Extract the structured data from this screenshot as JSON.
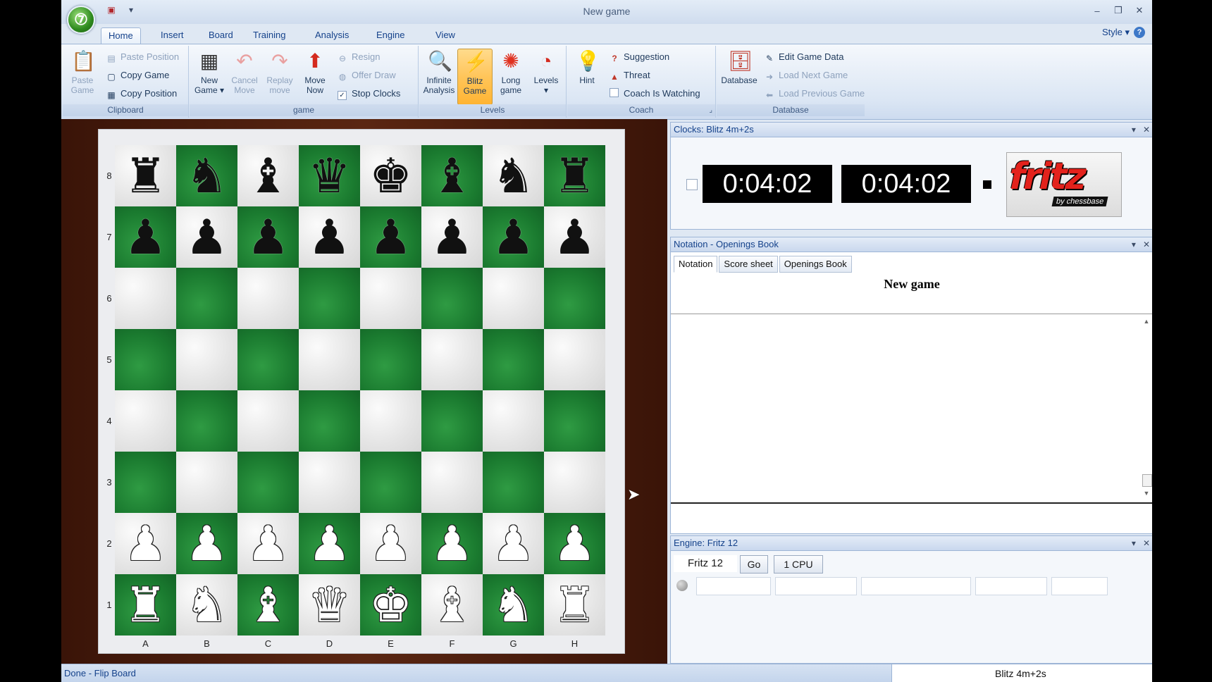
{
  "window": {
    "title": "New game",
    "app_icon": "fritz-orb-icon",
    "controls": [
      "minimize-icon",
      "restore-icon",
      "close-icon"
    ]
  },
  "ribbon": {
    "tabs": [
      "Home",
      "Insert",
      "Board",
      "Training",
      "Analysis",
      "Engine",
      "View"
    ],
    "active_tab": "Home",
    "style_label": "Style",
    "groups": {
      "clipboard": {
        "label": "Clipboard",
        "paste_game": "Paste Game",
        "paste_position": "Paste Position",
        "copy_game": "Copy Game",
        "copy_position": "Copy Position"
      },
      "game": {
        "label": "game",
        "new_game": "New Game",
        "cancel_move": "Cancel Move",
        "replay_move": "Replay move",
        "move_now": "Move Now",
        "resign": "Resign",
        "offer_draw": "Offer Draw",
        "stop_clocks": "Stop Clocks"
      },
      "levels": {
        "label": "Levels",
        "infinite_analysis": "Infinite Analysis",
        "blitz_game": "Blitz Game",
        "long_game": "Long game",
        "levels": "Levels"
      },
      "coach": {
        "label": "Coach",
        "hint": "Hint",
        "suggestion": "Suggestion",
        "threat": "Threat",
        "coach_watching": "Coach Is Watching"
      },
      "database": {
        "label": "Database",
        "database": "Database",
        "edit_game_data": "Edit Game Data",
        "load_next_game": "Load Next Game",
        "load_previous_game": "Load Previous Game"
      }
    }
  },
  "board": {
    "ranks": [
      "8",
      "7",
      "6",
      "5",
      "4",
      "3",
      "2",
      "1"
    ],
    "files": [
      "A",
      "B",
      "C",
      "D",
      "E",
      "F",
      "G",
      "H"
    ],
    "position": [
      [
        "bR",
        "bN",
        "bB",
        "bQ",
        "bK",
        "bB",
        "bN",
        "bR"
      ],
      [
        "bP",
        "bP",
        "bP",
        "bP",
        "bP",
        "bP",
        "bP",
        "bP"
      ],
      [
        "",
        "",
        "",
        "",
        "",
        "",
        "",
        ""
      ],
      [
        "",
        "",
        "",
        "",
        "",
        "",
        "",
        ""
      ],
      [
        "",
        "",
        "",
        "",
        "",
        "",
        "",
        ""
      ],
      [
        "",
        "",
        "",
        "",
        "",
        "",
        "",
        ""
      ],
      [
        "wP",
        "wP",
        "wP",
        "wP",
        "wP",
        "wP",
        "wP",
        "wP"
      ],
      [
        "wR",
        "wN",
        "wB",
        "wQ",
        "wK",
        "wB",
        "wN",
        "wR"
      ]
    ],
    "light_color": "#e6e6e6",
    "dark_color": "#1f8a36"
  },
  "clocks": {
    "title": "Clocks: Blitz 4m+2s",
    "white_time": "0:04:02",
    "black_time": "0:04:02"
  },
  "logo": {
    "word": "fritz",
    "sub": "by chessbase"
  },
  "notation": {
    "title": "Notation - Openings Book",
    "tabs": [
      "Notation",
      "Score sheet",
      "Openings Book"
    ],
    "active_tab": "Notation",
    "game_title": "New game"
  },
  "engine": {
    "title": "Engine: Fritz 12",
    "name": "Fritz 12",
    "go_label": "Go",
    "cpu_label": "1 CPU"
  },
  "status": {
    "left": "Done - Flip Board",
    "right": "Blitz 4m+2s"
  }
}
